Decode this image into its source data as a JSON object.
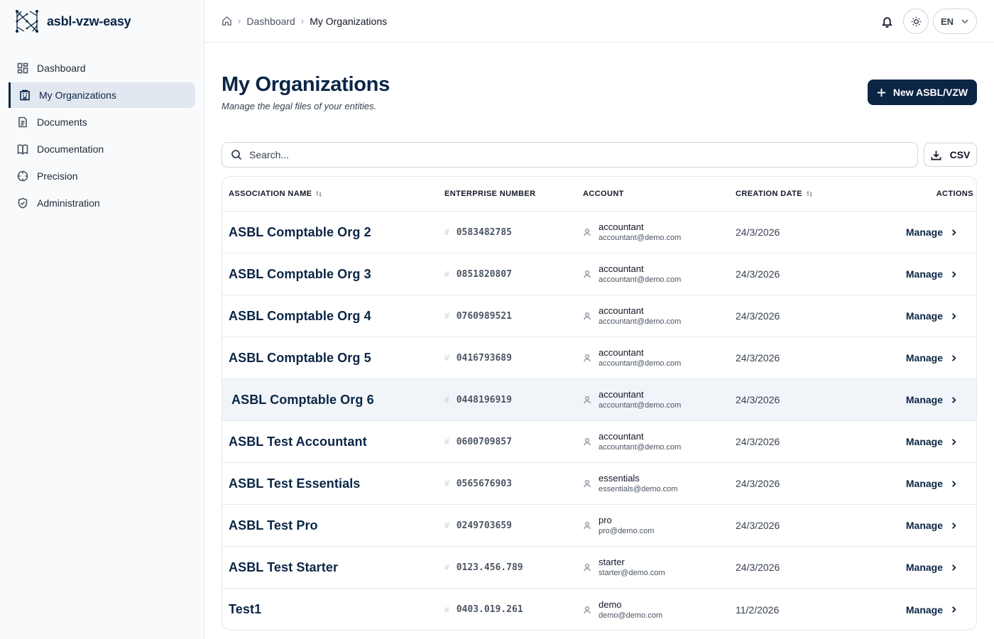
{
  "app": {
    "name": "asbl-vzw-easy"
  },
  "sidebar": {
    "items": [
      {
        "label": "Dashboard",
        "icon": "dashboard-icon",
        "active": false
      },
      {
        "label": "My Organizations",
        "icon": "building-icon",
        "active": true
      },
      {
        "label": "Documents",
        "icon": "document-icon",
        "active": false
      },
      {
        "label": "Documentation",
        "icon": "book-icon",
        "active": false
      },
      {
        "label": "Precision",
        "icon": "crosshair-icon",
        "active": false
      },
      {
        "label": "Administration",
        "icon": "shield-icon",
        "active": false
      }
    ]
  },
  "breadcrumb": {
    "items": [
      "Dashboard",
      "My Organizations"
    ]
  },
  "topbar": {
    "language": "EN"
  },
  "page": {
    "title": "My Organizations",
    "subtitle": "Manage the legal files of your entities.",
    "new_button_label": "New ASBL/VZW"
  },
  "search": {
    "placeholder": "Search...",
    "value": ""
  },
  "csv_button_label": "CSV",
  "table": {
    "headers": {
      "name": "ASSOCIATION NAME",
      "enterprise": "ENTERPRISE NUMBER",
      "account": "ACCOUNT",
      "date": "CREATION DATE",
      "actions": "ACTIONS"
    },
    "action_label": "Manage",
    "rows": [
      {
        "name": "ASBL Comptable Org 2",
        "enterprise": "0583482785",
        "account_name": "accountant",
        "account_email": "accountant@demo.com",
        "date": "24/3/2026"
      },
      {
        "name": "ASBL Comptable Org 3",
        "enterprise": "0851820807",
        "account_name": "accountant",
        "account_email": "accountant@demo.com",
        "date": "24/3/2026"
      },
      {
        "name": "ASBL Comptable Org 4",
        "enterprise": "0760989521",
        "account_name": "accountant",
        "account_email": "accountant@demo.com",
        "date": "24/3/2026"
      },
      {
        "name": "ASBL Comptable Org 5",
        "enterprise": "0416793689",
        "account_name": "accountant",
        "account_email": "accountant@demo.com",
        "date": "24/3/2026"
      },
      {
        "name": "ASBL Comptable Org 6",
        "enterprise": "0448196919",
        "account_name": "accountant",
        "account_email": "accountant@demo.com",
        "date": "24/3/2026",
        "highlighted": true
      },
      {
        "name": "ASBL Test Accountant",
        "enterprise": "0600709857",
        "account_name": "accountant",
        "account_email": "accountant@demo.com",
        "date": "24/3/2026"
      },
      {
        "name": "ASBL Test Essentials",
        "enterprise": "0565676903",
        "account_name": "essentials",
        "account_email": "essentials@demo.com",
        "date": "24/3/2026"
      },
      {
        "name": "ASBL Test Pro",
        "enterprise": "0249703659",
        "account_name": "pro",
        "account_email": "pro@demo.com",
        "date": "24/3/2026"
      },
      {
        "name": "ASBL Test Starter",
        "enterprise": "0123.456.789",
        "account_name": "starter",
        "account_email": "starter@demo.com",
        "date": "24/3/2026"
      },
      {
        "name": "Test1",
        "enterprise": "0403.019.261",
        "account_name": "demo",
        "account_email": "demo@demo.com",
        "date": "11/2/2026"
      }
    ]
  },
  "colors": {
    "brand": "#0b2545",
    "active_bg": "#e2e8f0",
    "highlight_row": "#f1f5f9"
  }
}
